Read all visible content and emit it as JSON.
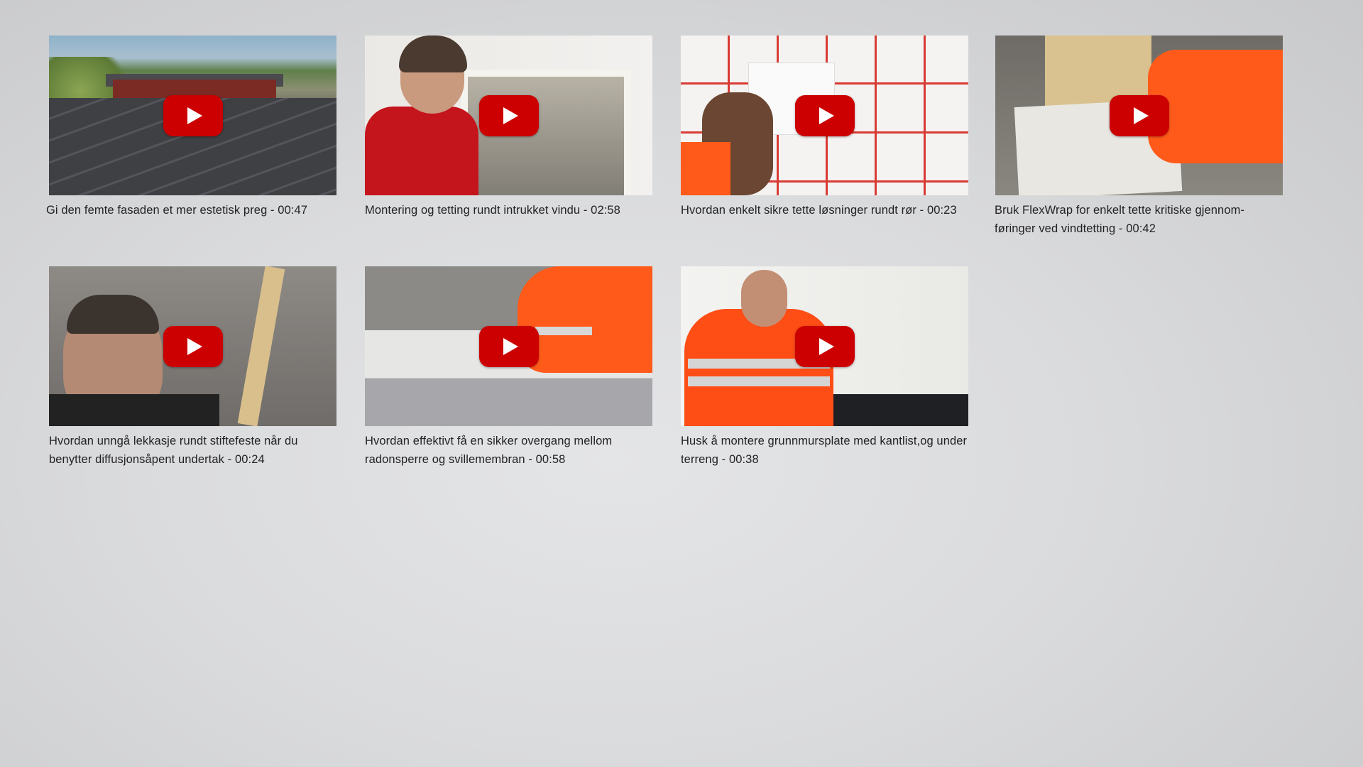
{
  "videos": [
    {
      "title": "Gi den femte fasaden et mer estetisk preg - 00:47",
      "thumbnail": "roof-houses-landscape"
    },
    {
      "title": "Montering og tetting rundt intrukket vindu - 02:58",
      "thumbnail": "worker-window-installation"
    },
    {
      "title": "Hvordan enkelt sikre tette løsninger rundt rør - 00:23",
      "thumbnail": "pipe-seal-grid-wall"
    },
    {
      "title": "Bruk FlexWrap for enkelt tette kritiske gjennom-føringer ved vindtetting - 00:42",
      "thumbnail": "flexwrap-wood-post"
    },
    {
      "title": "Hvordan unngå lekkasje rundt stiftefeste når du benytter diffusjonsåpent undertak - 00:24",
      "thumbnail": "man-holding-plank"
    },
    {
      "title": "Hvordan effektivt få en sikker overgang mellom radonsperre og svillemembran - 00:58",
      "thumbnail": "worker-floor-membrane"
    },
    {
      "title": "Husk å montere grunnmursplate med kantlist,og under terreng - 00:38",
      "thumbnail": "worker-foundation-board"
    }
  ],
  "colors": {
    "play_button": "#cc0000",
    "caption_text": "#222222"
  }
}
